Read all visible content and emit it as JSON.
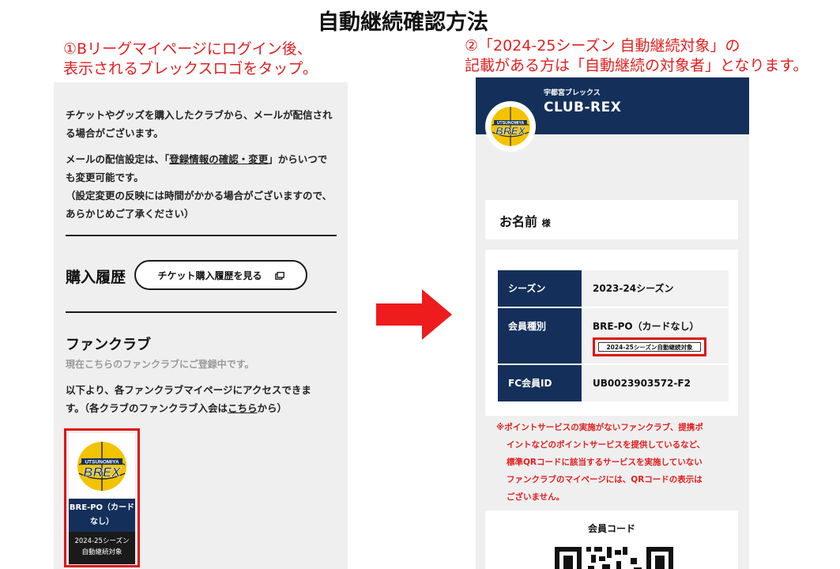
{
  "title": "自動継続確認方法",
  "steps": {
    "step1_line1": "①Bリーグマイページにログイン後、",
    "step1_line2": "表示されるブレックスロゴをタップ。",
    "step2_line1": "②「2024-25シーズン 自動継続対象」の",
    "step2_line2": "記載がある方は「自動継続の対象者」となります。"
  },
  "left_screen": {
    "mail_notice_line1": "チケットやグッズを購入したクラブから、メールが配信され",
    "mail_notice_line2": "る場合がございます。",
    "mail_settings_prefix": "メールの配信設定は、「",
    "mail_settings_link": "登録情報の確認・変更",
    "mail_settings_suffix": "」からいつで",
    "mail_settings_line2": "も変更可能です。",
    "mail_settings_line3": "（設定変更の反映には時間がかかる場合がございますので、",
    "mail_settings_line4": "あらかじめご了承ください）",
    "purchase_history_heading": "購入履歴",
    "ticket_history_button": "チケット購入履歴を見る",
    "fanclub_heading": "ファンクラブ",
    "registered_status": "現在こちらのファンクラブにご登録中です。",
    "access_line1": "以下より、各ファンクラブマイページにアクセスできま",
    "access_line2_prefix": "す。（各クラブのファンクラブ入会は",
    "access_link": "こちら",
    "access_line2_suffix": "から）",
    "card": {
      "logo_top": "UTSUNOMIYA",
      "logo_main": "BREX",
      "plan_line1": "BRE-PO（カード",
      "plan_line2": "なし）",
      "tag_line1": "2024-25シーズン",
      "tag_line2": "自動継続対象"
    }
  },
  "right_screen": {
    "club_subtitle": "宇都宮ブレックス",
    "club_name": "CLUB-REX",
    "logo_top": "UTSUNOMIYA",
    "logo_main": "BREX",
    "member_name": "お名前",
    "honorific": "様",
    "rows": [
      {
        "label": "シーズン",
        "value": "2023-24シーズン"
      },
      {
        "label": "会員種別",
        "value": "BRE-PO（カードなし）",
        "tag": "2024-25シーズン自動継続対象"
      },
      {
        "label": "FC会員ID",
        "value": "UB0023903572-F2"
      }
    ],
    "note_lines": [
      "※ポイントサービスの実施がないファンクラブ、提携ポ",
      "イントなどのポイントサービスを提供しているなど、",
      "標準QRコードに該当するサービスを実施していない",
      "ファンクラブのマイページには、QRコードの表示は",
      "ございません。"
    ],
    "member_code_label": "会員コード"
  },
  "colors": {
    "navy": "#14305a",
    "red": "#e02020",
    "panel_bg": "#efefef",
    "brex_yellow": "#f3c300"
  }
}
